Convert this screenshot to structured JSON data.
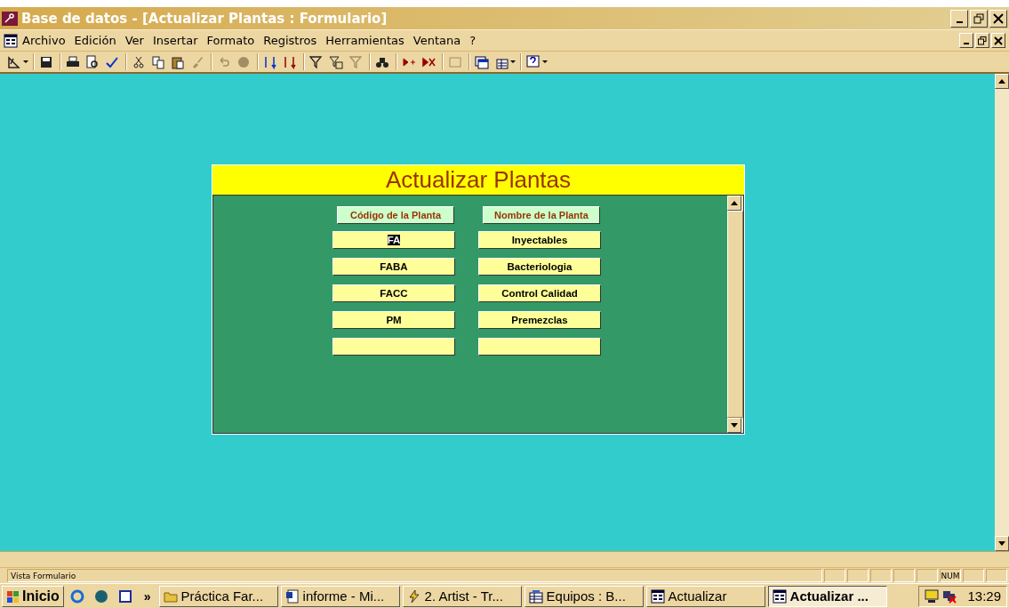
{
  "window": {
    "title": "Base de datos - [Actualizar Plantas : Formulario]"
  },
  "menu": [
    "Archivo",
    "Edición",
    "Ver",
    "Insertar",
    "Formato",
    "Registros",
    "Herramientas",
    "Ventana",
    "?"
  ],
  "toolbar": [
    {
      "disabled": false,
      "dropdown": true
    },
    {
      "disabled": false,
      "dropdown": false
    },
    {
      "disabled": false,
      "dropdown": false
    },
    {
      "disabled": false,
      "dropdown": false
    },
    {
      "disabled": false,
      "dropdown": false
    },
    {
      "disabled": false,
      "dropdown": false
    },
    {
      "disabled": false,
      "dropdown": false
    },
    {
      "disabled": false,
      "dropdown": false
    },
    {
      "disabled": true,
      "dropdown": false
    },
    {
      "disabled": true,
      "dropdown": false
    },
    {
      "disabled": true,
      "dropdown": false
    },
    {
      "disabled": false,
      "dropdown": false
    },
    {
      "disabled": false,
      "dropdown": false
    },
    {
      "disabled": false,
      "dropdown": false
    },
    {
      "disabled": false,
      "dropdown": false
    },
    {
      "disabled": true,
      "dropdown": false
    },
    {
      "disabled": false,
      "dropdown": false
    },
    {
      "disabled": false,
      "dropdown": false
    },
    {
      "disabled": false,
      "dropdown": false
    },
    {
      "disabled": true,
      "dropdown": false
    },
    {
      "disabled": false,
      "dropdown": false
    },
    {
      "disabled": false,
      "dropdown": true
    },
    {
      "disabled": false,
      "dropdown": true
    }
  ],
  "form": {
    "title": "Actualizar Plantas",
    "columns": [
      "Código de la Planta",
      "Nombre de la Planta"
    ],
    "rows": [
      {
        "code": "FA",
        "name": "Inyectables",
        "selected": true
      },
      {
        "code": "FABA",
        "name": "Bacteriologia",
        "selected": false
      },
      {
        "code": "FACC",
        "name": "Control Calidad",
        "selected": false
      },
      {
        "code": "PM",
        "name": "Premezclas",
        "selected": false
      },
      {
        "selected": false
      }
    ]
  },
  "status_bar": {
    "text": "Vista Formulario",
    "num_lock": "NUM"
  },
  "taskbar": {
    "start": "Inicio",
    "more": "»",
    "tasks": [
      {
        "label": "Práctica Far...",
        "selected": false
      },
      {
        "label": "informe - Mi...",
        "selected": false
      },
      {
        "label": "2. Artist - Tr...",
        "selected": false
      },
      {
        "label": "Equipos : B...",
        "selected": false
      },
      {
        "label": "Actualizar",
        "selected": false
      },
      {
        "label": "Actualizar ...",
        "selected": true
      }
    ],
    "clock": "13:29"
  }
}
